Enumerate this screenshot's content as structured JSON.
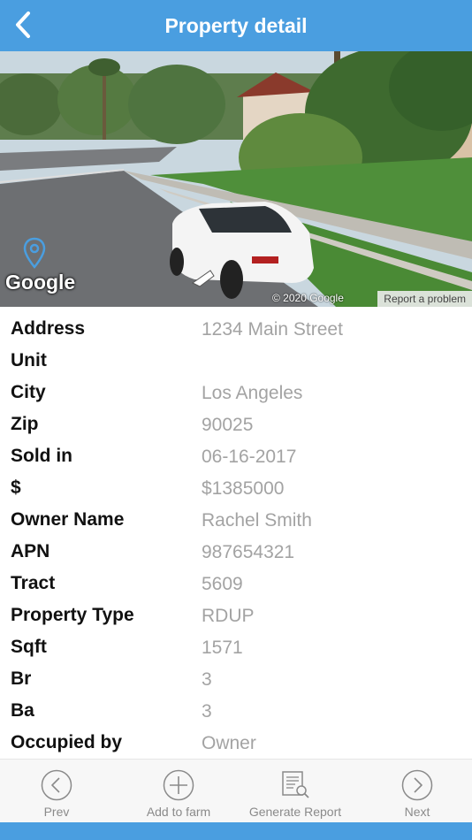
{
  "header": {
    "title": "Property detail",
    "back_icon": "chevron-left-icon",
    "background_color": "#4a9ee0"
  },
  "street_view": {
    "logo_text": "Google",
    "copyright": "© 2020 Google",
    "report_link": "Report a problem",
    "pin_icon": "location-pin-icon"
  },
  "details": [
    {
      "label": "Address",
      "value": "1234 Main Street"
    },
    {
      "label": "Unit",
      "value": ""
    },
    {
      "label": "City",
      "value": "Los Angeles"
    },
    {
      "label": "Zip",
      "value": "90025"
    },
    {
      "label": "Sold in",
      "value": "06-16-2017"
    },
    {
      "label": "$",
      "value": "$1385000"
    },
    {
      "label": "Owner Name",
      "value": "Rachel Smith"
    },
    {
      "label": "APN",
      "value": "987654321"
    },
    {
      "label": "Tract",
      "value": "5609"
    },
    {
      "label": "Property Type",
      "value": "RDUP"
    },
    {
      "label": "Sqft",
      "value": "1571"
    },
    {
      "label": "Br",
      "value": "3"
    },
    {
      "label": "Ba",
      "value": "3"
    },
    {
      "label": "Occupied by",
      "value": "Owner"
    }
  ],
  "toolbar": {
    "prev": {
      "label": "Prev",
      "icon": "chevron-left-circle-icon"
    },
    "add_to_farm": {
      "label": "Add to farm",
      "icon": "plus-circle-icon"
    },
    "generate_report": {
      "label": "Generate Report",
      "icon": "report-search-icon"
    },
    "next": {
      "label": "Next",
      "icon": "chevron-right-circle-icon"
    }
  },
  "colors": {
    "accent": "#4a9ee0",
    "label_text": "#111111",
    "value_text": "#a3a3a3",
    "toolbar_icon": "#8a8a8a"
  }
}
